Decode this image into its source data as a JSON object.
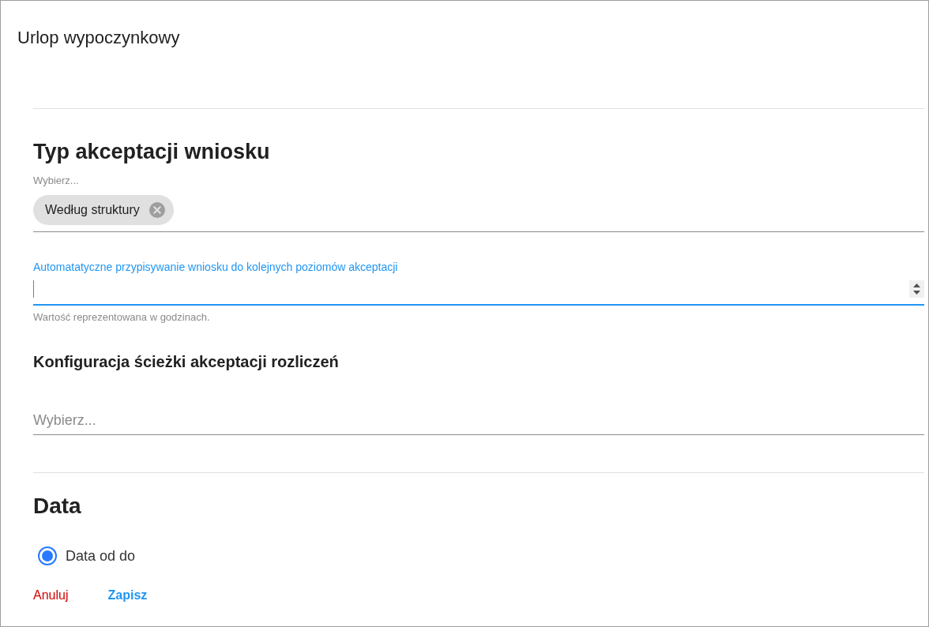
{
  "title": "Urlop wypoczynkowy",
  "acceptance_type": {
    "heading": "Typ akceptacji wniosku",
    "select": {
      "label": "Wybierz...",
      "chips": [
        {
          "label": "Według struktury"
        }
      ]
    }
  },
  "auto_assign_field": {
    "label": "Automatatyczne przypisywanie wniosku do kolejnych poziomów akceptacji",
    "focused": true,
    "helper": "Wartość reprezentowana w godzinach."
  },
  "settlement_path": {
    "heading": "Konfiguracja ścieżki akceptacji rozliczeń",
    "select": {
      "placeholder": "Wybierz..."
    }
  },
  "date": {
    "heading": "Data",
    "options": [
      {
        "label": "Data od do",
        "selected": true
      }
    ]
  },
  "actions": [
    {
      "kind": "cancel",
      "label": "Anuluj"
    },
    {
      "kind": "save",
      "label": "Zapisz"
    }
  ]
}
